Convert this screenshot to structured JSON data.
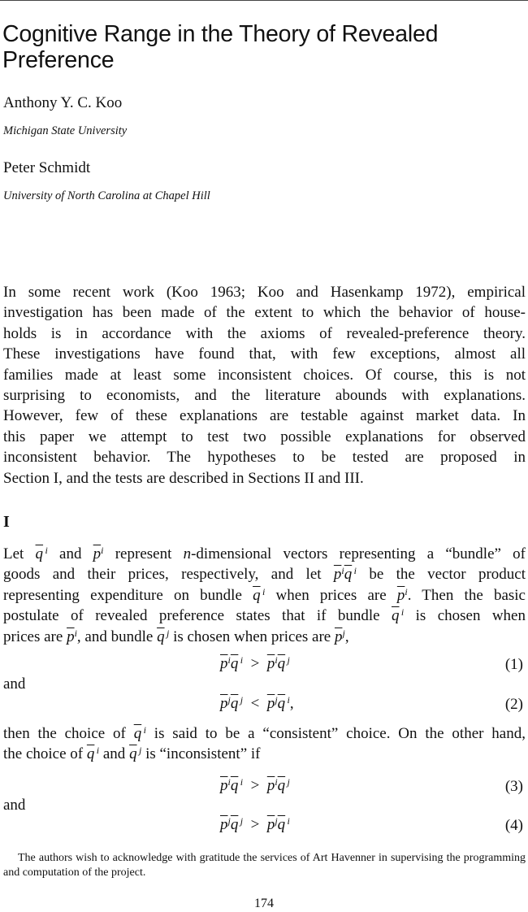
{
  "title": "Cognitive Range in the Theory of Revealed Preference",
  "authors": [
    {
      "name": "Anthony Y. C. Koo",
      "affiliation": "Michigan State University"
    },
    {
      "name": "Peter Schmidt",
      "affiliation": "University of North Carolina at Chapel Hill"
    }
  ],
  "intro_lines": [
    "In some recent work (Koo 1963; Koo and Hasenkamp 1972), empirical",
    "investigation has been made of the extent to which the behavior of house-",
    "holds is in accordance with the axioms of revealed-preference theory.",
    "These investigations have found that, with few exceptions, almost all",
    "families made at least some inconsistent choices. Of course, this is not",
    "surprising to economists, and the literature abounds with explanations.",
    "However, few of these explanations are testable against market data. In",
    "this paper we attempt to test two possible explanations for observed",
    "inconsistent behavior. The hypotheses to be tested are proposed in",
    "Section I, and the tests are described in Sections II and III."
  ],
  "section_heading": "I",
  "equations": [
    {
      "lhs_p": "p",
      "lhs_q": "q",
      "op": ">",
      "number": "(1)"
    },
    {
      "lhs_p": "p",
      "lhs_q": "q",
      "op": "<",
      "number": "(2)"
    },
    {
      "lhs_p": "p",
      "lhs_q": "q",
      "op": ">",
      "number": "(3)"
    },
    {
      "lhs_p": "p",
      "lhs_q": "q",
      "op": ">",
      "number": "(4)"
    }
  ],
  "connectors": {
    "and1": "and",
    "and2": "and"
  },
  "footnote": "The authors wish to acknowledge with gratitude the services of Art Havenner in supervising the programming and computation of the project.",
  "page_number": "174"
}
